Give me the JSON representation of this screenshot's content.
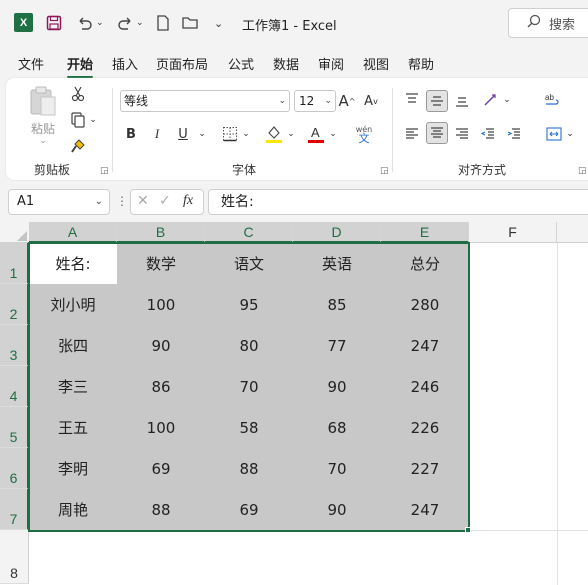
{
  "app": {
    "doc_title": "工作簿1  -  Excel",
    "search_placeholder": "搜索"
  },
  "menu": {
    "tabs": [
      "文件",
      "开始",
      "插入",
      "页面布局",
      "公式",
      "数据",
      "审阅",
      "视图",
      "帮助"
    ],
    "active_tab": "开始"
  },
  "ribbon": {
    "clipboard": {
      "paste_label": "粘贴",
      "group_label": "剪贴板"
    },
    "font": {
      "font_name": "等线",
      "font_size": "12",
      "bold": "B",
      "italic": "I",
      "underline": "U",
      "group_label": "字体",
      "grow": "A",
      "shrink": "A",
      "phonetic": "wén"
    },
    "alignment": {
      "group_label": "对齐方式"
    }
  },
  "formula_bar": {
    "name_box": "A1",
    "fx": "fx",
    "formula": "姓名:"
  },
  "sheet": {
    "columns": [
      "A",
      "B",
      "C",
      "D",
      "E",
      "F"
    ],
    "rows": [
      "1",
      "2",
      "3",
      "4",
      "5",
      "6",
      "7",
      "8"
    ],
    "cells": [
      [
        "姓名:",
        "数学",
        "语文",
        "英语",
        "总分"
      ],
      [
        "刘小明",
        "100",
        "95",
        "85",
        "280"
      ],
      [
        "张四",
        "90",
        "80",
        "77",
        "247"
      ],
      [
        "李三",
        "86",
        "70",
        "90",
        "246"
      ],
      [
        "王五",
        "100",
        "58",
        "68",
        "226"
      ],
      [
        "李明",
        "69",
        "88",
        "70",
        "227"
      ],
      [
        "周艳",
        "88",
        "69",
        "90",
        "247"
      ]
    ]
  },
  "colors": {
    "excel_green": "#1f6e43",
    "selection_fill": "#c8c8c8"
  }
}
